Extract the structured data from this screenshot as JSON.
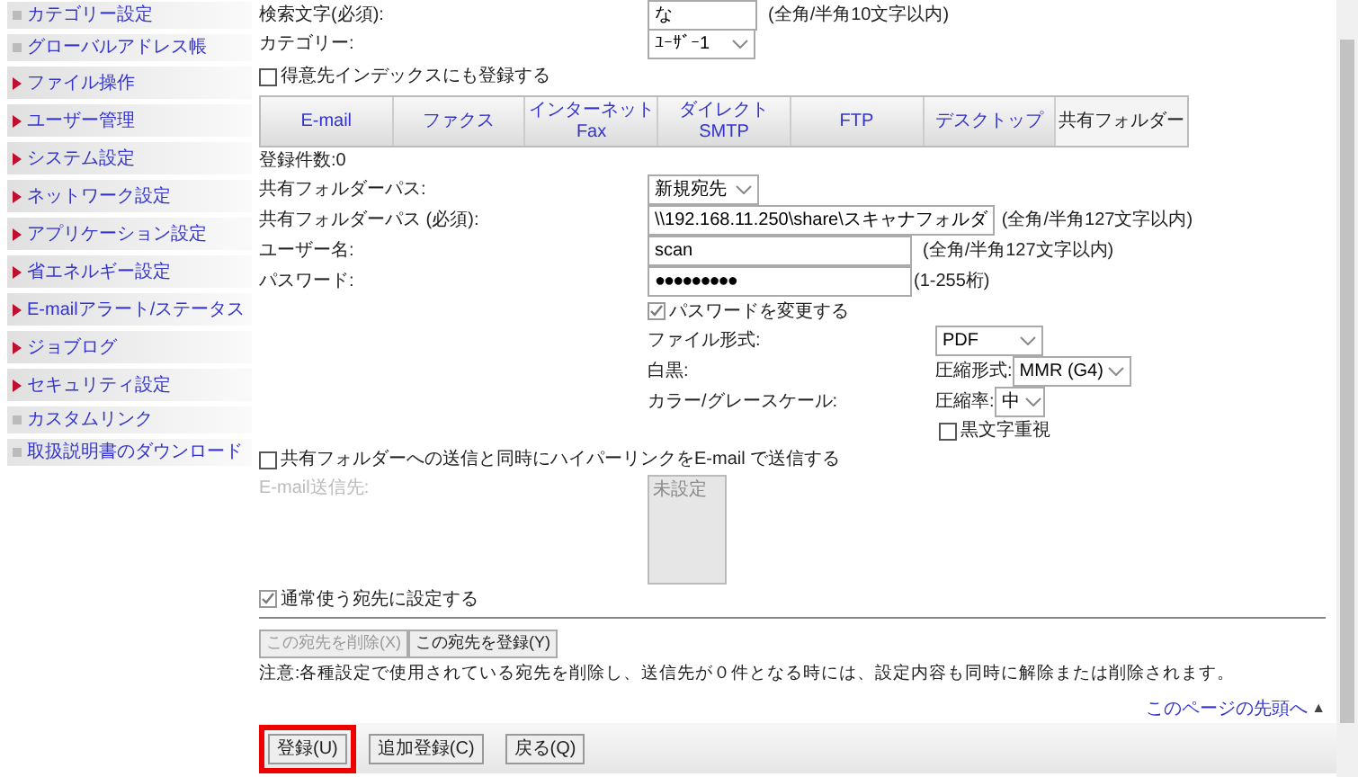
{
  "sidebar": {
    "items": [
      {
        "kind": "sub",
        "label": "カテゴリー設定"
      },
      {
        "kind": "sub",
        "label": "グローバルアドレス帳"
      },
      {
        "kind": "menu",
        "label": "ファイル操作"
      },
      {
        "kind": "menu",
        "label": "ユーザー管理"
      },
      {
        "kind": "menu",
        "label": "システム設定"
      },
      {
        "kind": "menu",
        "label": "ネットワーク設定"
      },
      {
        "kind": "menu",
        "label": "アプリケーション設定"
      },
      {
        "kind": "menu",
        "label": "省エネルギー設定"
      },
      {
        "kind": "menu",
        "label": "E-mailアラート/ステータス"
      },
      {
        "kind": "menu",
        "label": "ジョブログ"
      },
      {
        "kind": "menu",
        "label": "セキュリティ設定"
      },
      {
        "kind": "sub",
        "label": "カスタムリンク"
      },
      {
        "kind": "sub",
        "label": "取扱説明書のダウンロード"
      }
    ]
  },
  "search_text": {
    "label": "検索文字(必須):",
    "value": "な",
    "hint": "(全角/半角10文字以内)"
  },
  "category": {
    "label": "カテゴリー:",
    "value": "ﾕｰｻﾞｰ1"
  },
  "index_checkbox": {
    "label": "得意先インデックスにも登録する",
    "checked": false
  },
  "tabs": [
    {
      "label": "E-mail",
      "selected": false
    },
    {
      "label": "ファクス",
      "selected": false
    },
    {
      "label": "インターネット\nFax",
      "selected": false
    },
    {
      "label": "ダイレクトSMTP",
      "selected": false
    },
    {
      "label": "FTP",
      "selected": false
    },
    {
      "label": "デスクトップ",
      "selected": false
    },
    {
      "label": "共有フォルダー",
      "selected": true
    }
  ],
  "count": "登録件数:0",
  "folder_path_select": {
    "label": "共有フォルダーパス:",
    "value": "新規宛先"
  },
  "folder_path": {
    "label": "共有フォルダーパス (必須):",
    "value": "\\\\192.168.11.250\\share\\スキャナフォルダ",
    "hint": "(全角/半角127文字以内)"
  },
  "user_name": {
    "label": "ユーザー名:",
    "value": "scan",
    "hint": "(全角/半角127文字以内)"
  },
  "password": {
    "label": "パスワード:",
    "value": "●●●●●●●●●",
    "hint": "(1-255桁)"
  },
  "change_password": {
    "label": "パスワードを変更する",
    "checked": true
  },
  "file_format": {
    "label": "ファイル形式:",
    "value": "PDF"
  },
  "mono": {
    "label": "白黒:",
    "prefix": "圧縮形式:",
    "value": "MMR (G4)"
  },
  "color_gray": {
    "label": "カラー/グレースケール:",
    "prefix": "圧縮率:",
    "value": "中"
  },
  "black_text": {
    "label": "黒文字重視",
    "checked": false
  },
  "hyperlink": {
    "label": "共有フォルダーへの送信と同時にハイパーリンクをE-mail で送信する",
    "checked": false
  },
  "email_dest": {
    "label": "E-mail送信先:",
    "value": "未設定",
    "disabled": true
  },
  "frequent": {
    "label": "通常使う宛先に設定する",
    "checked": true
  },
  "entry_buttons": [
    {
      "label": "この宛先を削除(X)",
      "disabled": true
    },
    {
      "label": "この宛先を登録(Y)",
      "disabled": false
    }
  ],
  "note": "注意:各種設定で使用されている宛先を削除し、送信先が０件となる時には、設定内容も同時に解除または削除されます。",
  "page_top_link": "このページの先頭へ",
  "page_top_icon": "▲",
  "footer_buttons": [
    {
      "label": "登録(U)",
      "highlighted": true
    },
    {
      "label": "追加登録(C)",
      "highlighted": false
    },
    {
      "label": "戻る(Q)",
      "highlighted": false
    }
  ]
}
